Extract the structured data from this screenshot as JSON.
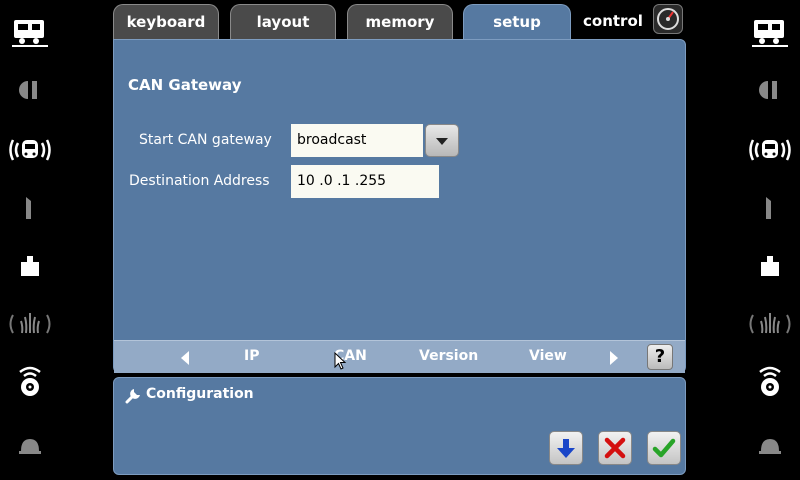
{
  "tabs": [
    {
      "label": "keyboard",
      "active": false
    },
    {
      "label": "layout",
      "active": false
    },
    {
      "label": "memory",
      "active": false
    },
    {
      "label": "setup",
      "active": true
    },
    {
      "label": "control",
      "active": false
    }
  ],
  "side_icons": [
    "locomotive-icon",
    "signal-icon",
    "radio-loco-icon",
    "track-icon",
    "weight-icon",
    "fountain-icon",
    "sound-icon",
    "bell-icon"
  ],
  "panel": {
    "title": "CAN Gateway",
    "start_label": "Start CAN gateway",
    "start_value": "broadcast",
    "dest_label": "Destination Address",
    "dest_value": "10 .0  .1  .255"
  },
  "subnav": {
    "items": [
      "IP",
      "CAN",
      "Version",
      "View"
    ],
    "selected": "CAN",
    "help_label": "?"
  },
  "config": {
    "title": "Configuration",
    "buttons": [
      "download-icon",
      "cancel-icon",
      "confirm-icon"
    ]
  },
  "colors": {
    "panel": "#5679a1",
    "subnav": "#93aac6",
    "tab_inactive": "#4a4a4a",
    "cancel": "#d41010",
    "confirm": "#28a428",
    "download": "#1a46c8"
  }
}
